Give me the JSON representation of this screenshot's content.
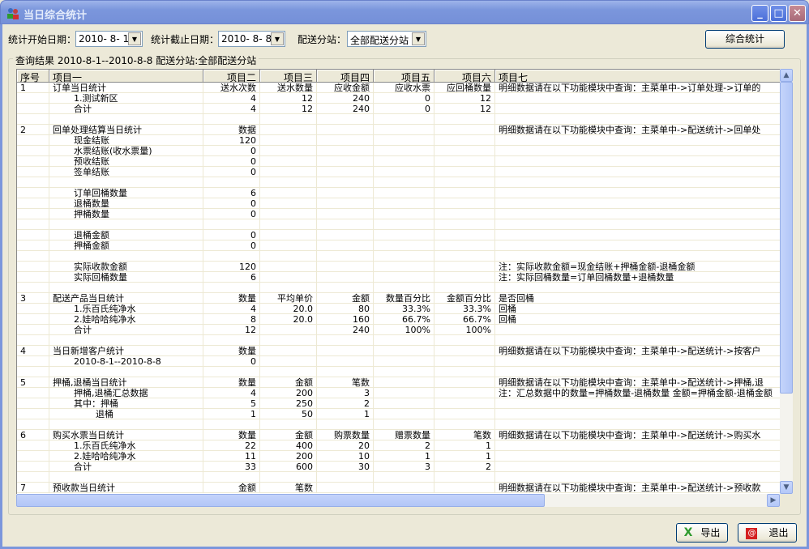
{
  "window": {
    "title": "当日综合统计",
    "minimize": "_",
    "maximize": "□",
    "close": "✕"
  },
  "filters": {
    "start_label": "统计开始日期：",
    "start_value": "2010- 8- 1",
    "end_label": "统计截止日期：",
    "end_value": "2010- 8- 8",
    "station_label": "配送分站：",
    "station_value": "全部配送分站",
    "run_button": "综合统计"
  },
  "result": {
    "title": "查询结果  2010-8-1--2010-8-8   配送分站:全部配送分站"
  },
  "table": {
    "columns": [
      "序号",
      "项目一",
      "项目二",
      "项目三",
      "项目四",
      "项目五",
      "项目六",
      "项目七"
    ],
    "rows": [
      [
        "1",
        "订单当日统计",
        "送水次数",
        "送水数量",
        "应收金额",
        "应收水票",
        "应回桶数量",
        "明细数据请在以下功能模块中查询：主菜单中->订单处理->订单的"
      ],
      [
        "",
        "1.测试新区",
        "4",
        "12",
        "240",
        "0",
        "12",
        ""
      ],
      [
        "",
        "合计",
        "4",
        "12",
        "240",
        "0",
        "12",
        ""
      ],
      [
        "",
        "",
        "",
        "",
        "",
        "",
        "",
        ""
      ],
      [
        "2",
        "回单处理结算当日统计",
        "数据",
        "",
        "",
        "",
        "",
        "明细数据请在以下功能模块中查询：主菜单中->配送统计->回单处"
      ],
      [
        "",
        "现金结账",
        "120",
        "",
        "",
        "",
        "",
        ""
      ],
      [
        "",
        "水票结账(收水票量)",
        "0",
        "",
        "",
        "",
        "",
        ""
      ],
      [
        "",
        "预收结账",
        "0",
        "",
        "",
        "",
        "",
        ""
      ],
      [
        "",
        "签单结账",
        "0",
        "",
        "",
        "",
        "",
        ""
      ],
      [
        "",
        "",
        "",
        "",
        "",
        "",
        "",
        ""
      ],
      [
        "",
        "订单回桶数量",
        "6",
        "",
        "",
        "",
        "",
        ""
      ],
      [
        "",
        "退桶数量",
        "0",
        "",
        "",
        "",
        "",
        ""
      ],
      [
        "",
        "押桶数量",
        "0",
        "",
        "",
        "",
        "",
        ""
      ],
      [
        "",
        "",
        "",
        "",
        "",
        "",
        "",
        ""
      ],
      [
        "",
        "退桶金额",
        "0",
        "",
        "",
        "",
        "",
        ""
      ],
      [
        "",
        "押桶金额",
        "0",
        "",
        "",
        "",
        "",
        ""
      ],
      [
        "",
        "",
        "",
        "",
        "",
        "",
        "",
        ""
      ],
      [
        "",
        "实际收款金额",
        "120",
        "",
        "",
        "",
        "",
        "注：实际收款金额=现金结账+押桶金额-退桶金额"
      ],
      [
        "",
        "实际回桶数量",
        "6",
        "",
        "",
        "",
        "",
        "注：实际回桶数量=订单回桶数量+退桶数量"
      ],
      [
        "",
        "",
        "",
        "",
        "",
        "",
        "",
        ""
      ],
      [
        "3",
        "配送产品当日统计",
        "数量",
        "平均单价",
        "金额",
        "数量百分比",
        "金额百分比",
        "是否回桶"
      ],
      [
        "",
        "1.乐百氏纯净水",
        "4",
        "20.0",
        "80",
        "33.3%",
        "33.3%",
        "回桶"
      ],
      [
        "",
        "2.娃哈哈纯净水",
        "8",
        "20.0",
        "160",
        "66.7%",
        "66.7%",
        "回桶"
      ],
      [
        "",
        "合计",
        "12",
        "",
        "240",
        "100%",
        "100%",
        ""
      ],
      [
        "",
        "",
        "",
        "",
        "",
        "",
        "",
        ""
      ],
      [
        "4",
        "当日新增客户统计",
        "数量",
        "",
        "",
        "",
        "",
        "明细数据请在以下功能模块中查询：主菜单中->配送统计->按客户"
      ],
      [
        "",
        "2010-8-1--2010-8-8",
        "0",
        "",
        "",
        "",
        "",
        ""
      ],
      [
        "",
        "",
        "",
        "",
        "",
        "",
        "",
        ""
      ],
      [
        "5",
        "押桶,退桶当日统计",
        "数量",
        "金额",
        "笔数",
        "",
        "",
        "明细数据请在以下功能模块中查询：主菜单中->配送统计->押桶,退"
      ],
      [
        "",
        "押桶,退桶汇总数据",
        "4",
        "200",
        "3",
        "",
        "",
        "注：汇总数据中的数量=押桶数量-退桶数量  金额=押桶金额-退桶金额"
      ],
      [
        "",
        "其中：押桶",
        "5",
        "250",
        "2",
        "",
        "",
        ""
      ],
      [
        "",
        "退桶",
        "1",
        "50",
        "1",
        "",
        "",
        ""
      ],
      [
        "",
        "",
        "",
        "",
        "",
        "",
        "",
        ""
      ],
      [
        "6",
        "购买水票当日统计",
        "数量",
        "金额",
        "购票数量",
        "赠票数量",
        "笔数",
        "明细数据请在以下功能模块中查询：主菜单中->配送统计->购买水"
      ],
      [
        "",
        "1.乐百氏纯净水",
        "22",
        "400",
        "20",
        "2",
        "1",
        ""
      ],
      [
        "",
        "2.娃哈哈纯净水",
        "11",
        "200",
        "10",
        "1",
        "1",
        ""
      ],
      [
        "",
        "合计",
        "33",
        "600",
        "30",
        "3",
        "2",
        ""
      ],
      [
        "",
        "",
        "",
        "",
        "",
        "",
        "",
        ""
      ],
      [
        "7",
        "预收款当日统计",
        "金额",
        "笔数",
        "",
        "",
        "",
        "明细数据请在以下功能模块中查询：主菜单中->配送统计->预收款"
      ]
    ]
  },
  "footer": {
    "export_button": "导出",
    "exit_button": "退出"
  },
  "colors": {
    "titlebar": "#7b96dc",
    "face": "#ece9d8",
    "export_icon": "#2e9a2e",
    "exit_icon": "#d42020"
  }
}
